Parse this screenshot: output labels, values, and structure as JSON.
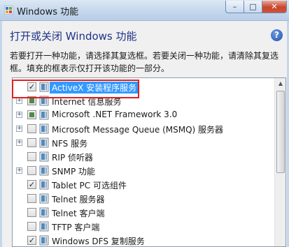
{
  "window": {
    "title": "Windows 功能",
    "controls": {
      "minimize": "–",
      "maximize": "□",
      "close": "✕"
    }
  },
  "heading": "打开或关闭 Windows 功能",
  "help_icon": "?",
  "description": "若要打开一种功能，请选择其复选框。若要关闭一种功能，请清除其复选框。填充的框表示仅打开该功能的一部分。",
  "features": [
    {
      "label": "ActiveX 安装程序服务",
      "state": "checked",
      "expandable": false,
      "selected": true,
      "checkmark": "✓"
    },
    {
      "label": "Internet 信息服务",
      "state": "partial",
      "expandable": true,
      "selected": false
    },
    {
      "label": "Microsoft .NET Framework 3.0",
      "state": "partial",
      "expandable": true,
      "selected": false
    },
    {
      "label": "Microsoft Message Queue (MSMQ) 服务器",
      "state": "unchecked",
      "expandable": true,
      "selected": false
    },
    {
      "label": "NFS 服务",
      "state": "unchecked",
      "expandable": true,
      "selected": false
    },
    {
      "label": "RIP 侦听器",
      "state": "unchecked",
      "expandable": false,
      "selected": false
    },
    {
      "label": "SNMP 功能",
      "state": "unchecked",
      "expandable": true,
      "selected": false
    },
    {
      "label": "Tablet PC 可选组件",
      "state": "checked",
      "expandable": false,
      "selected": false,
      "checkmark": "✓"
    },
    {
      "label": "Telnet 服务器",
      "state": "unchecked",
      "expandable": false,
      "selected": false
    },
    {
      "label": "Telnet 客户端",
      "state": "unchecked",
      "expandable": false,
      "selected": false
    },
    {
      "label": "TFTP 客户端",
      "state": "unchecked",
      "expandable": false,
      "selected": false
    },
    {
      "label": "Windows DFS 复制服务",
      "state": "checked",
      "expandable": false,
      "selected": false,
      "checkmark": "✓"
    }
  ],
  "expander_symbol": "+",
  "scroll_up_symbol": "▲",
  "colors": {
    "selection": "#3399ff",
    "highlight_box": "#e0201c",
    "partial_fill": "#4f8a47"
  }
}
